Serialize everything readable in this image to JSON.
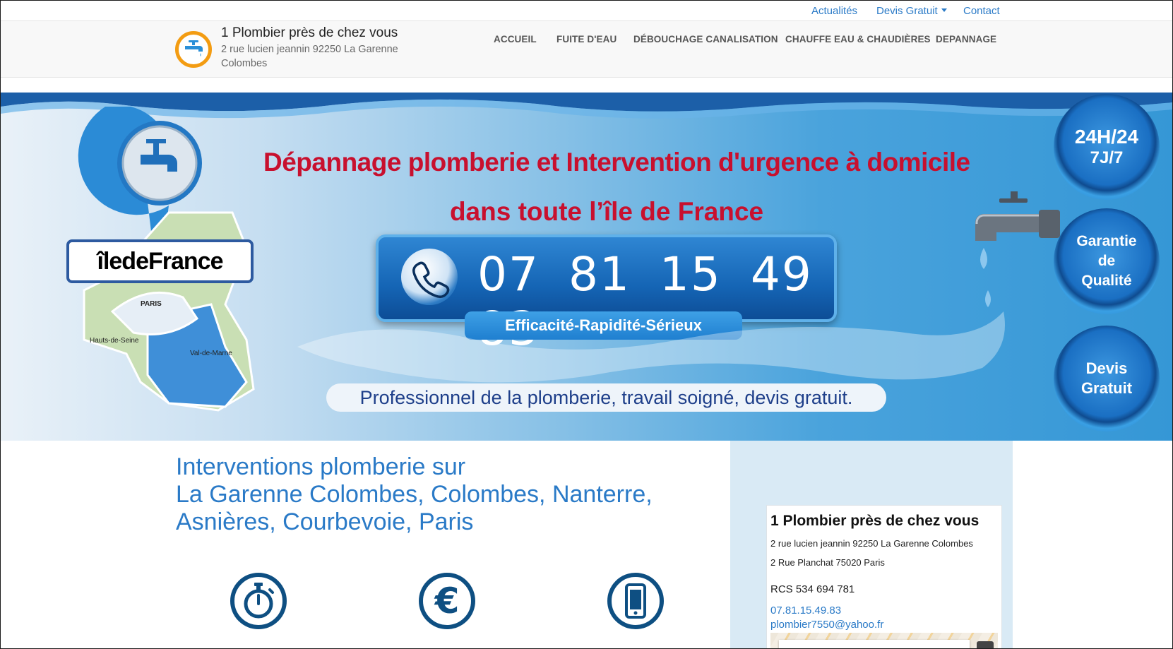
{
  "topbar": {
    "actualites": "Actualités",
    "devis": "Devis Gratuit",
    "contact": "Contact"
  },
  "brand": {
    "title": "1 Plombier près de chez vous",
    "address": "2 rue lucien jeannin 92250 La Garenne Colombes"
  },
  "nav": {
    "accueil": "ACCUEIL",
    "fuite": "FUITE D'EAU",
    "debouchage": "DÉBOUCHAGE CANALISATION",
    "chauffe": "CHAUFFE EAU & CHAUDIÈRES",
    "depannage": "DEPANNAGE"
  },
  "banner": {
    "headline1": "Dépannage plomberie et Intervention d'urgence à domicile",
    "headline2": "dans toute l’île de France",
    "phone": "07 81 15 49 83",
    "tagline": "Efficacité-Rapidité-Sérieux",
    "pro": "Professionnel de la plomberie, travail soigné, devis gratuit.",
    "idf_logo": "îledeFrance",
    "map_labels": {
      "paris": "PARIS",
      "hauts": "Hauts-de-Seine",
      "val": "Val-de-Marne"
    },
    "badges": {
      "b1_l1": "24H/24",
      "b1_l2": "7J/7",
      "b2_l1": "Garantie",
      "b2_l2": "de",
      "b2_l3": "Qualité",
      "b3_l1": "Devis",
      "b3_l2": "Gratuit"
    }
  },
  "content": {
    "heading_l1": "Interventions plomberie sur",
    "heading_l2": "La Garenne Colombes, Colombes, Nanterre,",
    "heading_l3": "Asnières, Courbevoie, Paris",
    "icons": [
      "stopwatch-icon",
      "euro-icon",
      "smartphone-icon"
    ]
  },
  "sidebar": {
    "title": "1 Plombier près de chez vous",
    "addr1": "2 rue lucien jeannin 92250 La Garenne Colombes",
    "addr2": "2 Rue Planchat 75020 Paris",
    "rcs": "RCS 534 694 781",
    "tel": "07.81.15.49.83",
    "email": "plombier7550@yahoo.fr"
  },
  "colors": {
    "link": "#2a7ac7",
    "headline_red": "#c8102e",
    "icon_navy": "#0e4f82",
    "logo_orange": "#f39c12",
    "sidebar_bg": "#d9eaf5"
  }
}
